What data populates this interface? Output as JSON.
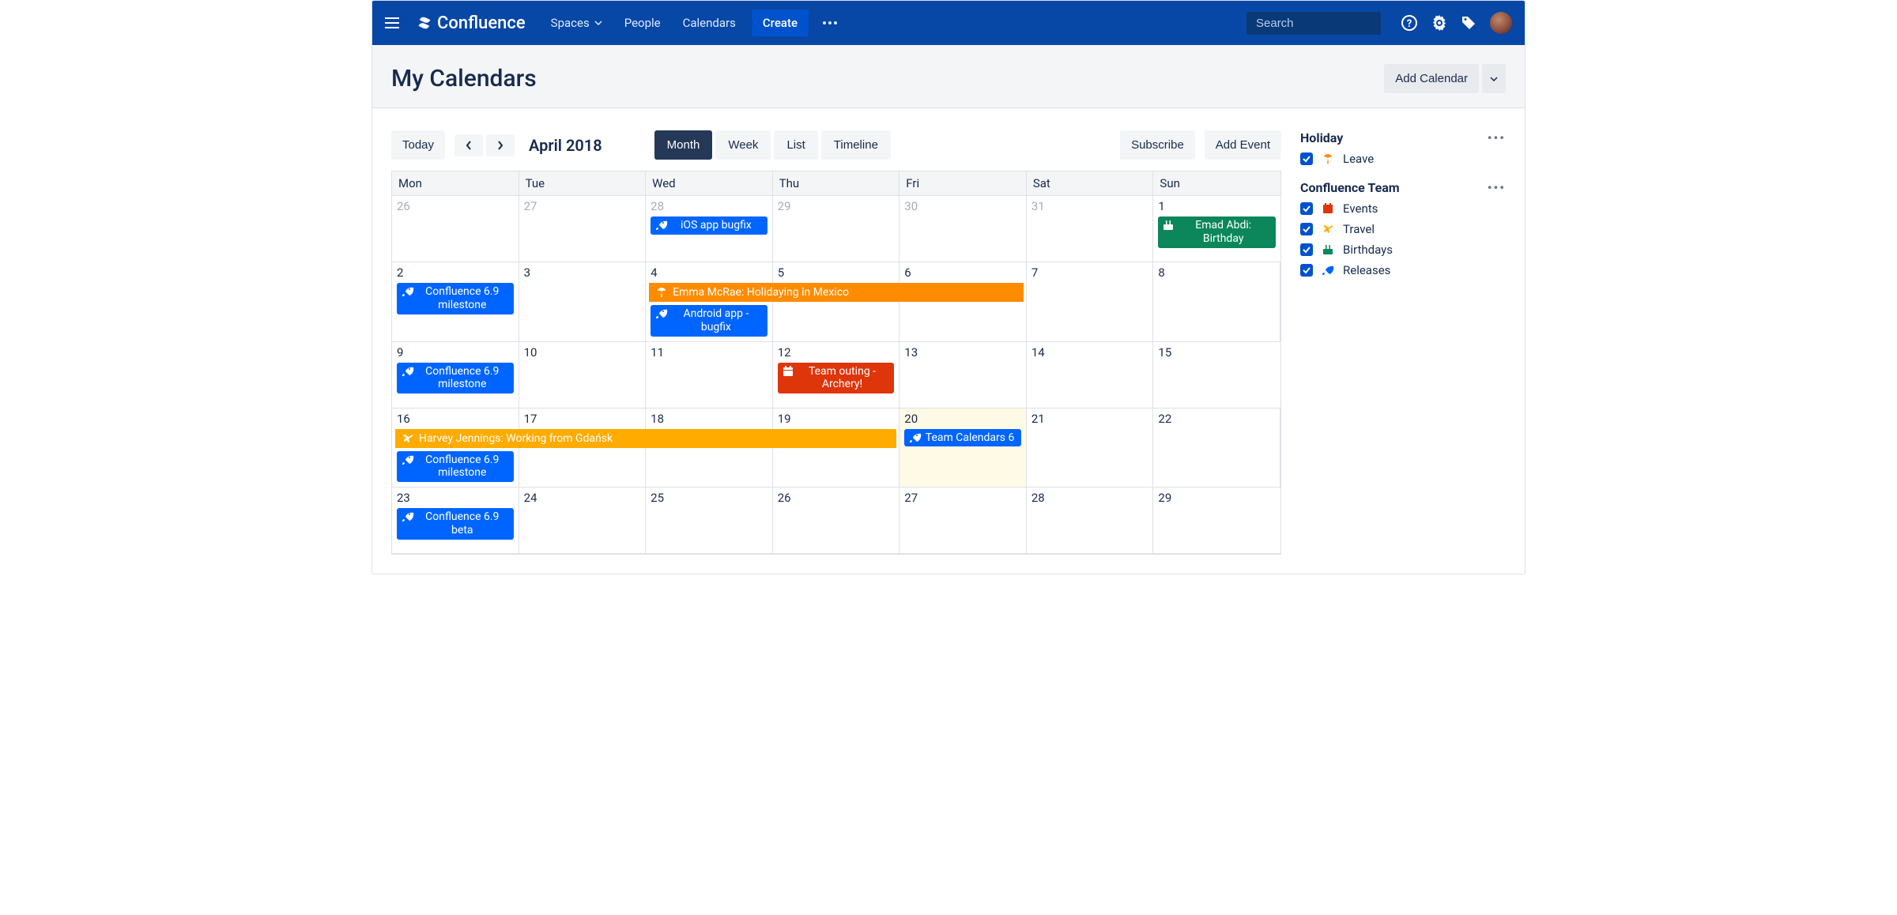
{
  "colors": {
    "blue": "#0065ff",
    "green": "#0b875b",
    "red": "#de350b",
    "orange": "#ff8b00",
    "yellow": "#ffab00"
  },
  "nav": {
    "brand": "Confluence",
    "links": {
      "spaces": "Spaces",
      "people": "People",
      "calendars": "Calendars"
    },
    "create": "Create",
    "search_placeholder": "Search"
  },
  "page": {
    "title": "My Calendars",
    "add_calendar": "Add Calendar"
  },
  "toolbar": {
    "today": "Today",
    "period": "April 2018",
    "views": {
      "month": "Month",
      "week": "Week",
      "list": "List",
      "timeline": "Timeline"
    },
    "subscribe": "Subscribe",
    "add_event": "Add Event"
  },
  "weekdays": [
    "Mon",
    "Tue",
    "Wed",
    "Thu",
    "Fri",
    "Sat",
    "Sun"
  ],
  "weeks": [
    {
      "days": [
        {
          "num": "26",
          "dim": true
        },
        {
          "num": "27",
          "dim": true
        },
        {
          "num": "28",
          "dim": true,
          "events": [
            {
              "type": "release",
              "color": "blue",
              "text": "iOS app bugfix"
            }
          ]
        },
        {
          "num": "29",
          "dim": true
        },
        {
          "num": "30",
          "dim": true
        },
        {
          "num": "31",
          "dim": true
        },
        {
          "num": "1",
          "events": [
            {
              "type": "birthday",
              "color": "green",
              "text": "Emad Abdi: Birthday"
            }
          ]
        }
      ]
    },
    {
      "banner": {
        "type": "leave",
        "color": "orange",
        "text": "Emma McRae: Holidaying in Mexico",
        "startCol": 2,
        "span": 3
      },
      "days": [
        {
          "num": "2",
          "events": [
            {
              "type": "release",
              "color": "blue",
              "text": "Confluence 6.9 milestone"
            }
          ]
        },
        {
          "num": "3"
        },
        {
          "num": "4",
          "bannerPad": true,
          "events": [
            {
              "type": "release",
              "color": "blue",
              "text": "Android app - bugfix"
            }
          ]
        },
        {
          "num": "5",
          "bannerPad": true
        },
        {
          "num": "6",
          "bannerPad": true
        },
        {
          "num": "7"
        },
        {
          "num": "8"
        }
      ]
    },
    {
      "days": [
        {
          "num": "9",
          "events": [
            {
              "type": "release",
              "color": "blue",
              "text": "Confluence 6.9 milestone"
            }
          ]
        },
        {
          "num": "10"
        },
        {
          "num": "11"
        },
        {
          "num": "12",
          "events": [
            {
              "type": "event",
              "color": "red",
              "text": "Team outing - Archery!"
            }
          ]
        },
        {
          "num": "13"
        },
        {
          "num": "14"
        },
        {
          "num": "15"
        }
      ]
    },
    {
      "banner": {
        "type": "travel",
        "color": "yellow",
        "text": "Harvey Jennings: Working from Gdańsk",
        "startCol": 0,
        "span": 4
      },
      "days": [
        {
          "num": "16",
          "bannerPad": true,
          "events": [
            {
              "type": "release",
              "color": "blue",
              "text": "Confluence 6.9 milestone"
            }
          ]
        },
        {
          "num": "17",
          "bannerPad": true
        },
        {
          "num": "18",
          "bannerPad": true
        },
        {
          "num": "19",
          "bannerPad": true
        },
        {
          "num": "20",
          "today": true,
          "events": [
            {
              "type": "release",
              "color": "blue",
              "text": "Team Calendars 6"
            }
          ]
        },
        {
          "num": "21"
        },
        {
          "num": "22"
        }
      ]
    },
    {
      "days": [
        {
          "num": "23",
          "events": [
            {
              "type": "release",
              "color": "blue",
              "text": "Confluence 6.9 beta"
            }
          ]
        },
        {
          "num": "24"
        },
        {
          "num": "25"
        },
        {
          "num": "26"
        },
        {
          "num": "27"
        },
        {
          "num": "28"
        },
        {
          "num": "29"
        }
      ]
    }
  ],
  "sidebar": {
    "groups": [
      {
        "title": "Holiday",
        "types": [
          {
            "name": "Leave",
            "icon": "leave",
            "iconColor": "#ff8b00",
            "checked": true
          }
        ]
      },
      {
        "title": "Confluence Team",
        "types": [
          {
            "name": "Events",
            "icon": "event",
            "iconColor": "#de350b",
            "checked": true
          },
          {
            "name": "Travel",
            "icon": "travel",
            "iconColor": "#ffab00",
            "checked": true
          },
          {
            "name": "Birthdays",
            "icon": "birthday",
            "iconColor": "#0b875b",
            "checked": true
          },
          {
            "name": "Releases",
            "icon": "release",
            "iconColor": "#0065ff",
            "checked": true
          }
        ]
      }
    ]
  }
}
